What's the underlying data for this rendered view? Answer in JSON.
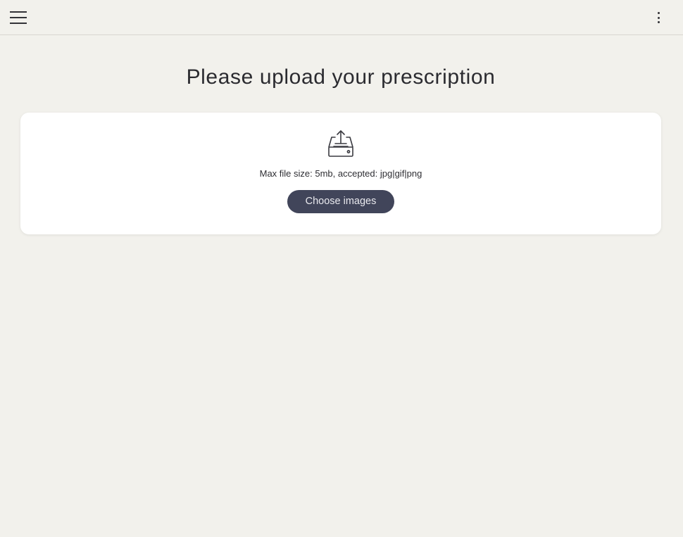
{
  "header": {
    "menu_icon": "hamburger-menu-icon",
    "more_icon": "vertical-dots-icon"
  },
  "main": {
    "title": "Please upload your prescription",
    "upload": {
      "icon": "upload-tray-icon",
      "hint": "Max file size: 5mb, accepted: jpg|gif|png",
      "button_label": "Choose images"
    }
  },
  "colors": {
    "background": "#f2f1ec",
    "card": "#ffffff",
    "button": "#41455a",
    "button_text": "#e9e9ee",
    "text": "#2e2e33"
  }
}
